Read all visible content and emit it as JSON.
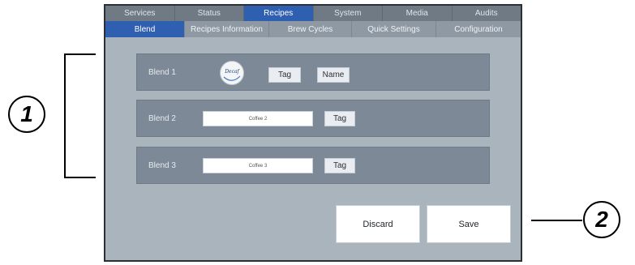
{
  "main_tabs": [
    {
      "label": "Services",
      "active": false
    },
    {
      "label": "Status",
      "active": false
    },
    {
      "label": "Recipes",
      "active": true
    },
    {
      "label": "System",
      "active": false
    },
    {
      "label": "Media",
      "active": false
    },
    {
      "label": "Audits",
      "active": false
    }
  ],
  "sub_tabs": [
    {
      "label": "Blend",
      "active": true
    },
    {
      "label": "Recipes Information",
      "active": false
    },
    {
      "label": "Brew Cycles",
      "active": false
    },
    {
      "label": "Quick Settings",
      "active": false
    },
    {
      "label": "Configuration",
      "active": false
    }
  ],
  "blends": [
    {
      "label": "Blend 1",
      "logo_text": "Decaf",
      "tag_label": "Tag",
      "name_label": "Name"
    },
    {
      "label": "Blend 2",
      "field_value": "Coffee 2",
      "tag_label": "Tag"
    },
    {
      "label": "Blend 3",
      "field_value": "Coffee 3",
      "tag_label": "Tag"
    }
  ],
  "actions": {
    "discard_label": "Discard",
    "save_label": "Save"
  },
  "callouts": {
    "one": "1",
    "two": "2"
  },
  "colors": {
    "accent": "#2f5fb0",
    "panel": "#7d8996",
    "background": "#aab4bd"
  }
}
